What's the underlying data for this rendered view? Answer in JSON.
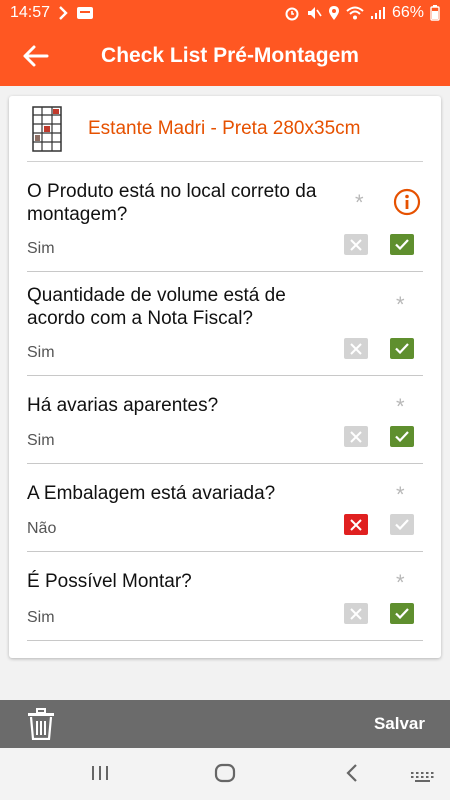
{
  "status_bar": {
    "time": "14:57",
    "battery": "66%"
  },
  "app_bar": {
    "title": "Check List Pré-Montagem"
  },
  "product": {
    "name": "Estante Madri - Preta 280x35cm"
  },
  "questions": [
    {
      "text": "O Produto está no local correto da montagem?",
      "answer": "Sim",
      "required_mark": "*",
      "has_info": true,
      "state": "yes"
    },
    {
      "text": "Quantidade de volume está de acordo com a Nota Fiscal?",
      "answer": "Sim",
      "required_mark": "*",
      "state": "yes"
    },
    {
      "text": "Há avarias aparentes?",
      "answer": "Sim",
      "required_mark": "*",
      "state": "yes"
    },
    {
      "text": "A Embalagem está avariada?",
      "answer": "Não",
      "required_mark": "*",
      "state": "no"
    },
    {
      "text": "É Possível Montar?",
      "answer": "Sim",
      "required_mark": "*",
      "state": "yes"
    }
  ],
  "bottom_bar": {
    "save_label": "Salvar"
  },
  "colors": {
    "primary": "#ff5722",
    "product_text": "#e65100",
    "yes_active": "#5f8f2e",
    "no_active": "#e02020",
    "inactive": "#d3d3d3"
  }
}
